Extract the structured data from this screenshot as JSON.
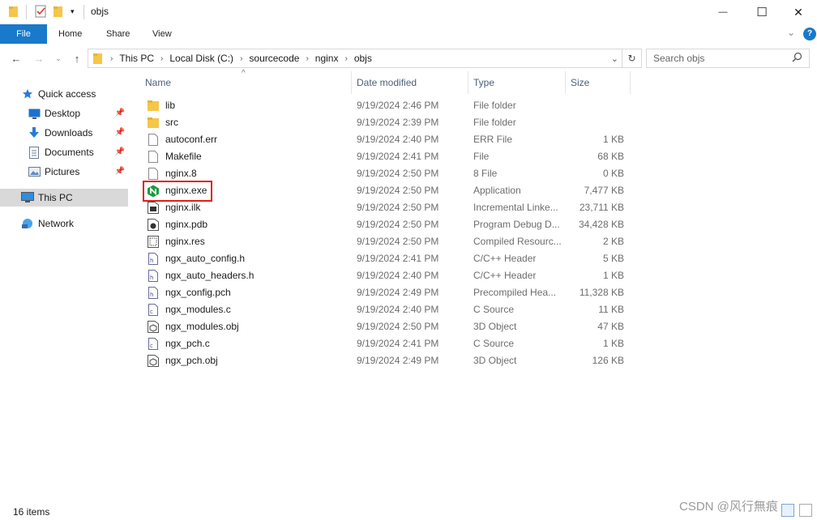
{
  "window": {
    "title": "objs",
    "minimize_glyph": "—",
    "maximize_glyph": "☐",
    "close_glyph": "✕"
  },
  "ribbon": {
    "tabs": [
      "File",
      "Home",
      "Share",
      "View"
    ]
  },
  "address": {
    "crumbs": [
      "This PC",
      "Local Disk (C:)",
      "sourcecode",
      "nginx",
      "objs"
    ],
    "search_placeholder": "Search objs"
  },
  "nav": {
    "quick_access": "Quick access",
    "desktop": "Desktop",
    "downloads": "Downloads",
    "documents": "Documents",
    "pictures": "Pictures",
    "this_pc": "This PC",
    "network": "Network"
  },
  "columns": {
    "name": "Name",
    "date": "Date modified",
    "type": "Type",
    "size": "Size"
  },
  "files": [
    {
      "name": "lib",
      "date": "9/19/2024 2:46 PM",
      "type": "File folder",
      "size": "",
      "icon": "folder-icon"
    },
    {
      "name": "src",
      "date": "9/19/2024 2:39 PM",
      "type": "File folder",
      "size": "",
      "icon": "folder-icon"
    },
    {
      "name": "autoconf.err",
      "date": "9/19/2024 2:40 PM",
      "type": "ERR File",
      "size": "1 KB",
      "icon": "file-icon"
    },
    {
      "name": "Makefile",
      "date": "9/19/2024 2:41 PM",
      "type": "File",
      "size": "68 KB",
      "icon": "file-icon"
    },
    {
      "name": "nginx.8",
      "date": "9/19/2024 2:50 PM",
      "type": "8 File",
      "size": "0 KB",
      "icon": "file-icon"
    },
    {
      "name": "nginx.exe",
      "date": "9/19/2024 2:50 PM",
      "type": "Application",
      "size": "7,477 KB",
      "icon": "nginx-app-icon"
    },
    {
      "name": "nginx.ilk",
      "date": "9/19/2024 2:50 PM",
      "type": "Incremental Linke...",
      "size": "23,711 KB",
      "icon": "ilk-file-icon"
    },
    {
      "name": "nginx.pdb",
      "date": "9/19/2024 2:50 PM",
      "type": "Program Debug D...",
      "size": "34,428 KB",
      "icon": "pdb-file-icon"
    },
    {
      "name": "nginx.res",
      "date": "9/19/2024 2:50 PM",
      "type": "Compiled Resourc...",
      "size": "2 KB",
      "icon": "res-file-icon"
    },
    {
      "name": "ngx_auto_config.h",
      "date": "9/19/2024 2:41 PM",
      "type": "C/C++ Header",
      "size": "5 KB",
      "icon": "header-file-icon"
    },
    {
      "name": "ngx_auto_headers.h",
      "date": "9/19/2024 2:40 PM",
      "type": "C/C++ Header",
      "size": "1 KB",
      "icon": "header-file-icon"
    },
    {
      "name": "ngx_config.pch",
      "date": "9/19/2024 2:49 PM",
      "type": "Precompiled Hea...",
      "size": "11,328 KB",
      "icon": "header-file-icon"
    },
    {
      "name": "ngx_modules.c",
      "date": "9/19/2024 2:40 PM",
      "type": "C Source",
      "size": "11 KB",
      "icon": "c-source-icon"
    },
    {
      "name": "ngx_modules.obj",
      "date": "9/19/2024 2:50 PM",
      "type": "3D Object",
      "size": "47 KB",
      "icon": "obj-file-icon"
    },
    {
      "name": "ngx_pch.c",
      "date": "9/19/2024 2:41 PM",
      "type": "C Source",
      "size": "1 KB",
      "icon": "c-source-icon"
    },
    {
      "name": "ngx_pch.obj",
      "date": "9/19/2024 2:49 PM",
      "type": "3D Object",
      "size": "126 KB",
      "icon": "obj-file-icon"
    }
  ],
  "status": {
    "item_count": "16 items"
  },
  "watermark": "CSDN @风行無痕",
  "colors": {
    "file_tab": "#1979ca",
    "highlight_box": "#e21b1b",
    "folder": "#f4c649",
    "nginx_green": "#1a9c3f"
  }
}
